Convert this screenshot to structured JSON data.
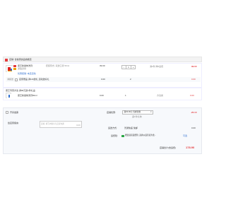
{
  "store": {
    "title": "店铺: 合婆康食品旗舰店",
    "checked": true
  },
  "item1": {
    "name": "康王新健效洗剂",
    "description_line2": "送贴身替",
    "spec": "套装形式: 双送口罩 50ml",
    "price": "39.00",
    "qty": "1",
    "stock_note": "满2件 降5运费",
    "subtotal": "99.00",
    "promo_label": "优惠促销: 本店活动",
    "gift_row": {
      "label": "满额送",
      "text": "店家赠品 满119送礼 活动送好礼",
      "price": "0.00",
      "qty": "2",
      "subtotal": "0.00"
    }
  },
  "item2": {
    "shop_line": "康王专营方法 满99元送1件礼盒",
    "name": "康王新健效洗剂50ml",
    "price": "0.00",
    "qty": "1",
    "action": "方法类",
    "subtotal": "0.00"
  },
  "bottom": {
    "invoice_label": "开具发票",
    "remark_label": "给店家留言:",
    "remark_placeholder": "选填, 填写内容可与店家沟通",
    "remark_counter": "0/200",
    "discount_label": "店铺优惠:",
    "discount_select": "满29.90元 包邮优惠",
    "discount_amount": "-20.10",
    "discount_sub": "返1件礼物",
    "delivery_label": "运送方式:",
    "delivery_value": "普通快递 免邮",
    "delivery_amount": "0.00",
    "assurance_label": "运费险:",
    "assurance_text": "赠送退货运费险, 退换以运营商为准...",
    "assurance_link": "可选",
    "total_label": "店铺合计(含运费)",
    "total_value": "178.90"
  },
  "colors": {
    "accent_red": "#e4393c",
    "link_blue": "#2f6fd0",
    "green_tag": "#2aa745"
  }
}
